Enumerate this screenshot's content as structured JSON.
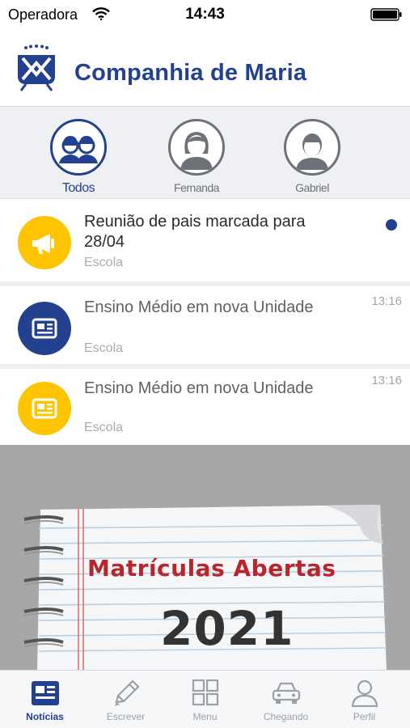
{
  "status_bar": {
    "carrier": "Operadora",
    "time": "14:43"
  },
  "header": {
    "title": "Companhia de Maria"
  },
  "profiles": [
    {
      "label": "Todos",
      "active": true
    },
    {
      "label": "Fernanda",
      "active": false
    },
    {
      "label": "Gabriel",
      "active": false
    }
  ],
  "feed": [
    {
      "title": "Reunião de pais marcada para 28/04",
      "category": "Escola",
      "time": "",
      "unread": true,
      "icon": "megaphone-icon",
      "icon_color": "#ffc400"
    },
    {
      "title": "Ensino Médio em nova Unidade",
      "category": "Escola",
      "time": "13:16",
      "unread": false,
      "icon": "newspaper-icon",
      "icon_color": "#23418e"
    },
    {
      "title": "Ensino Médio em nova Unidade",
      "category": "Escola",
      "time": "13:16",
      "unread": false,
      "icon": "newspaper-icon",
      "icon_color": "#ffc400"
    }
  ],
  "banner": {
    "title": "Matrículas Abertas",
    "year": "2021"
  },
  "tabs": [
    {
      "label": "Notícias",
      "icon": "news-icon",
      "active": true
    },
    {
      "label": "Escrever",
      "icon": "pencil-icon",
      "active": false
    },
    {
      "label": "Menu",
      "icon": "grid-icon",
      "active": false
    },
    {
      "label": "Chegando",
      "icon": "car-icon",
      "active": false
    },
    {
      "label": "Perfil",
      "icon": "user-icon",
      "active": false
    }
  ],
  "colors": {
    "brand": "#23418e",
    "accent_yellow": "#ffc400",
    "unread_dot": "#23418e"
  }
}
